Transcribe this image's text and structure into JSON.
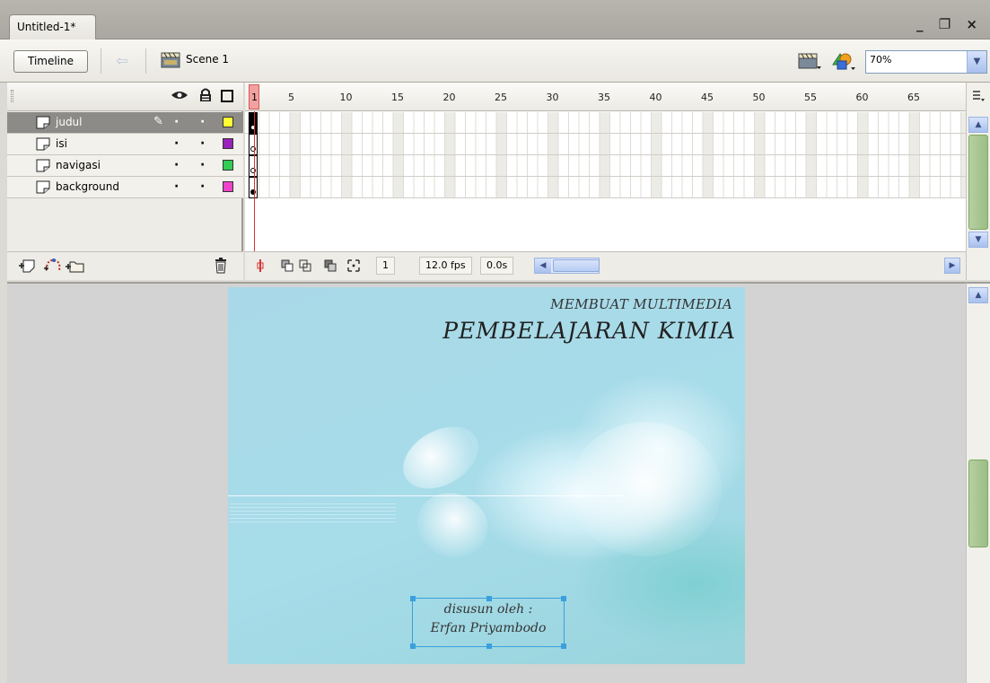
{
  "document": {
    "tab_title": "Untitled-1*"
  },
  "window_controls": {
    "minimize": "_",
    "restore": "❐",
    "close": "×"
  },
  "editbar": {
    "timeline_label": "Timeline",
    "scene_label": "Scene 1",
    "zoom_value": "70%"
  },
  "layers": [
    {
      "name": "judul",
      "color": "#ffff33",
      "selected": true,
      "keyframe": "filled"
    },
    {
      "name": "isi",
      "color": "#9922bb",
      "selected": false,
      "keyframe": "empty"
    },
    {
      "name": "navigasi",
      "color": "#33cc55",
      "selected": false,
      "keyframe": "empty"
    },
    {
      "name": "background",
      "color": "#ee44cc",
      "selected": false,
      "keyframe": "filled"
    }
  ],
  "frame_numbers": [
    "1",
    "5",
    "10",
    "15",
    "20",
    "25",
    "30",
    "35",
    "40",
    "45",
    "50",
    "55",
    "60",
    "65"
  ],
  "status": {
    "current_frame": "1",
    "frame_rate": "12.0 fps",
    "elapsed": "0.0s"
  },
  "stage": {
    "subtitle": "MEMBUAT MULTIMEDIA",
    "title": "PEMBELAJARAN KIMIA",
    "credit_line1": "disusun oleh :",
    "credit_line2": "Erfan Priyambodo"
  },
  "colors": {
    "stage_bg": "#a9d9e8",
    "selected_layer_bg": "#8c8b87",
    "playhead": "#d63333",
    "selection_outline": "#3aa0dd"
  }
}
